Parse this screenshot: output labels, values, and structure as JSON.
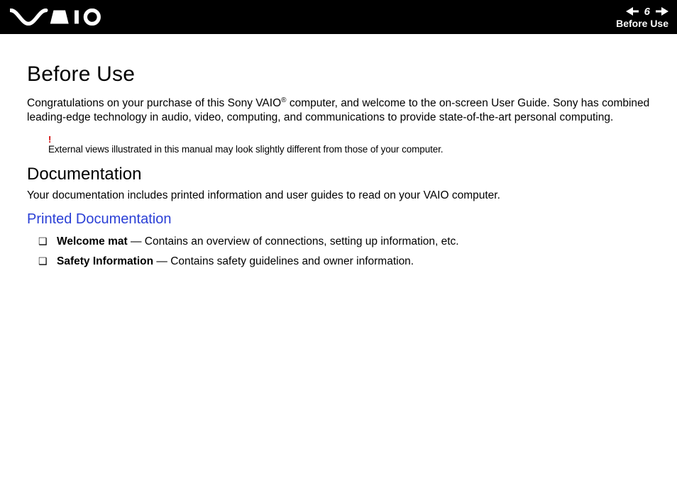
{
  "header": {
    "page_number": "6",
    "section_label": "Before Use"
  },
  "content": {
    "title": "Before Use",
    "intro_pre": "Congratulations on your purchase of this Sony VAIO",
    "intro_sup": "®",
    "intro_post": " computer, and welcome to the on-screen User Guide. Sony has combined leading-edge technology in audio, video, computing, and communications to provide state-of-the-art personal computing.",
    "note_bang": "!",
    "note_text": "External views illustrated in this manual may look slightly different from those of your computer.",
    "doc_heading": "Documentation",
    "doc_intro": "Your documentation includes printed information and user guides to read on your VAIO computer.",
    "printed_heading": "Printed Documentation",
    "items": [
      {
        "title": "Welcome mat",
        "desc": " — Contains an overview of connections, setting up information, etc."
      },
      {
        "title": "Safety Information",
        "desc": " — Contains safety guidelines and owner information."
      }
    ]
  }
}
